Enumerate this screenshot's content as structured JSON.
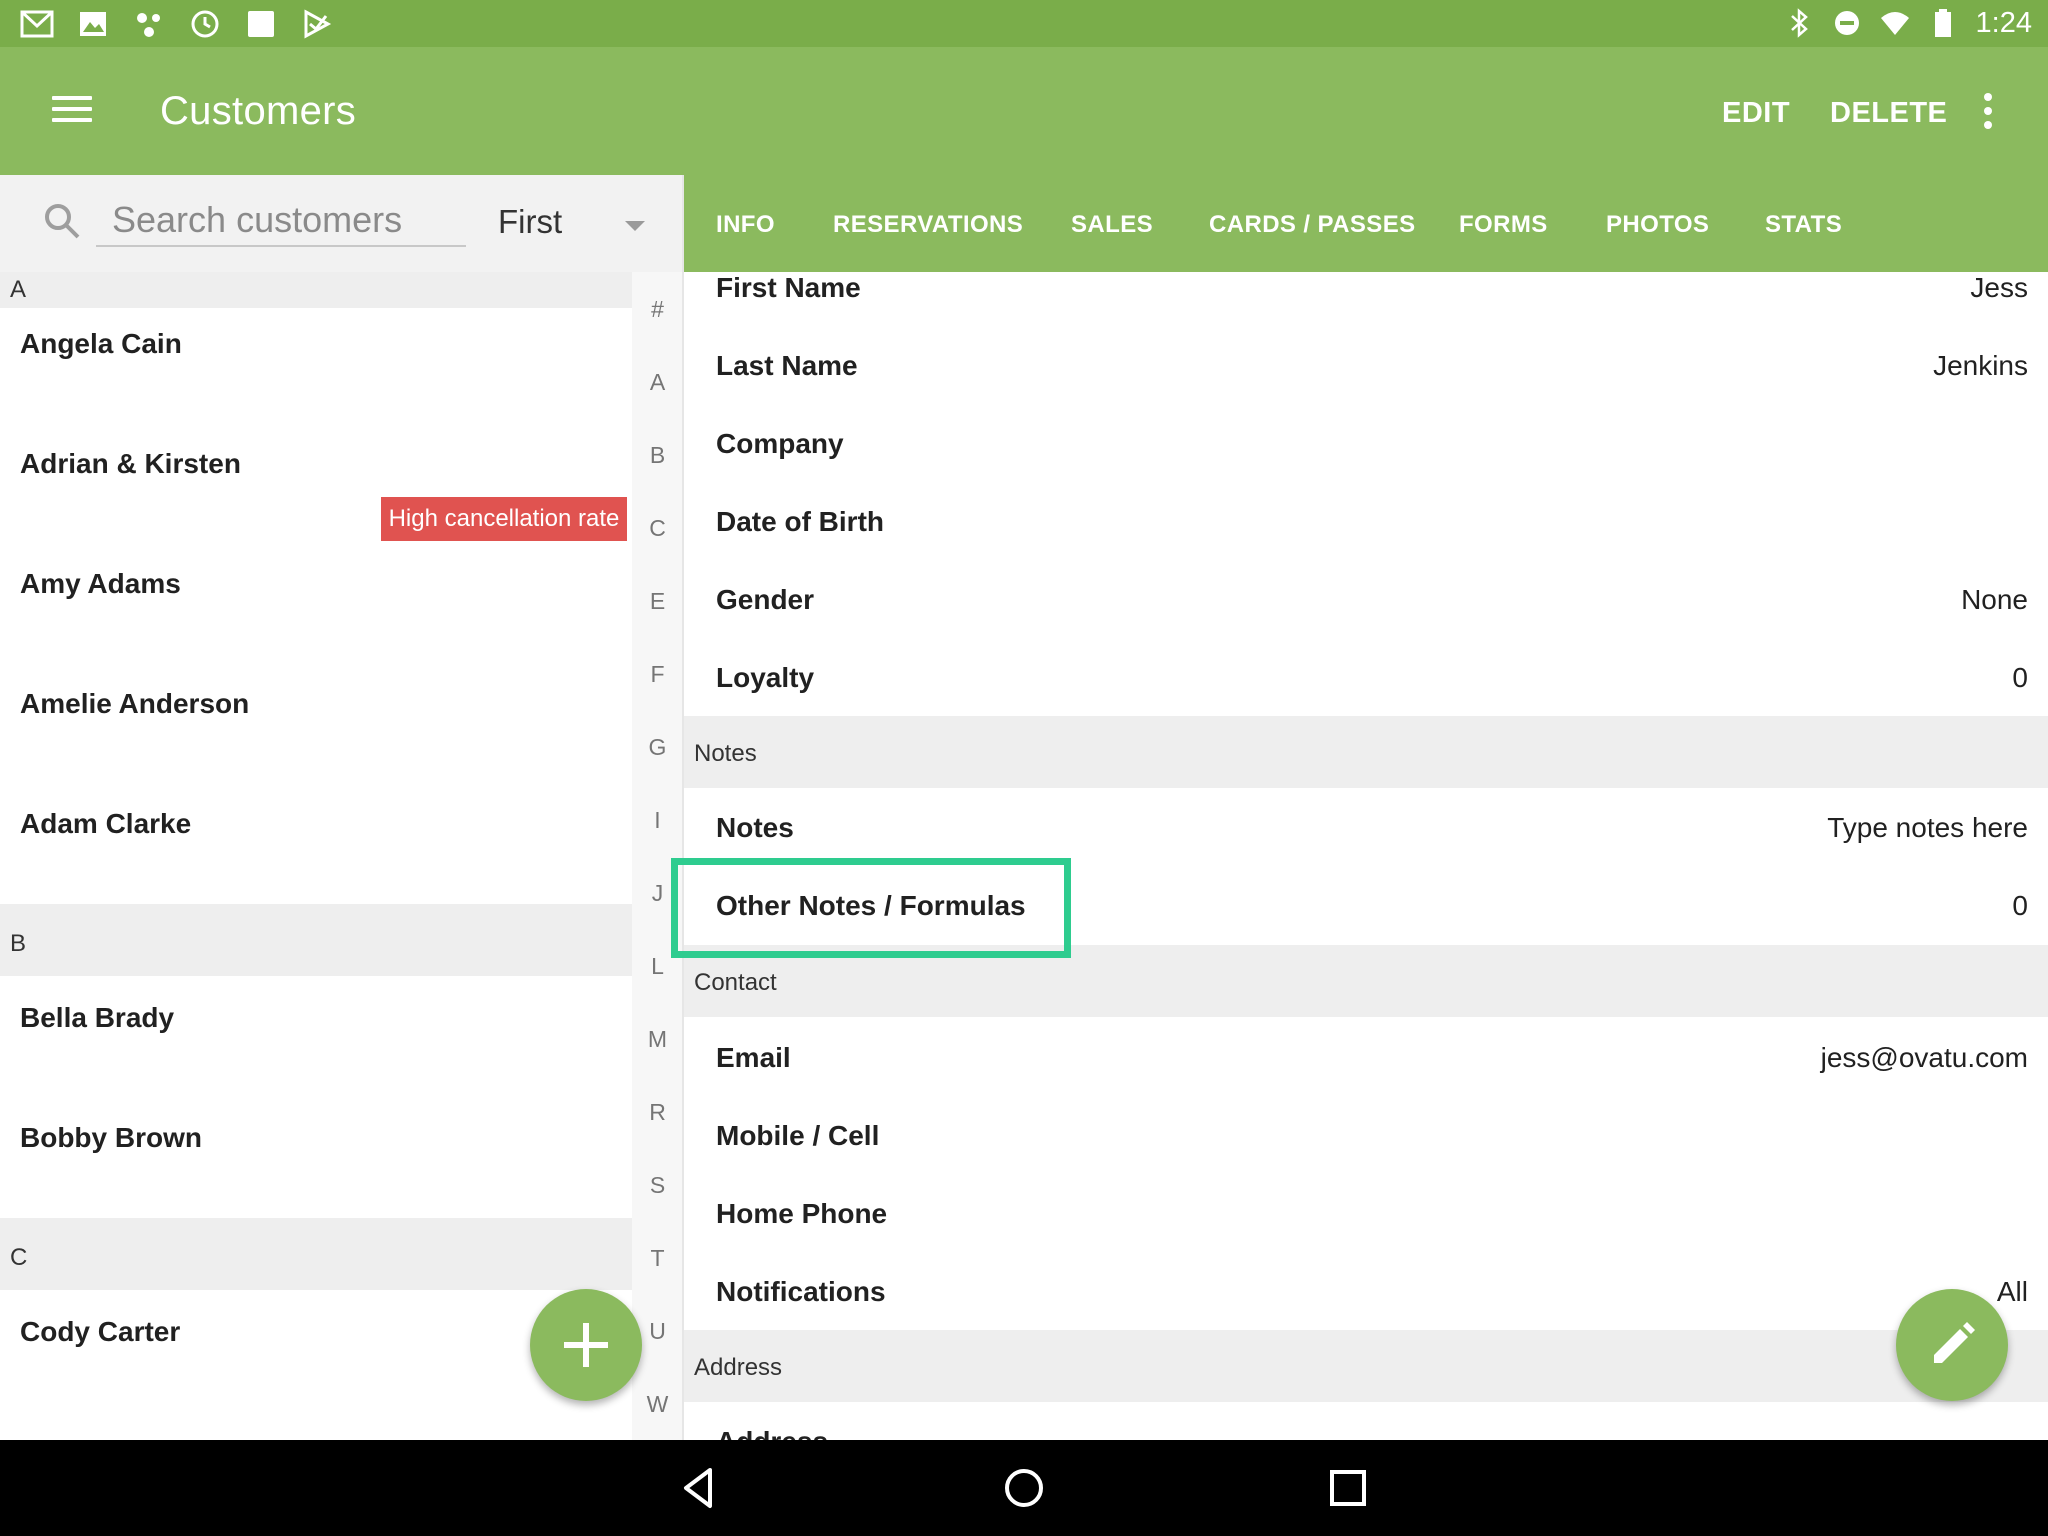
{
  "status_bar": {
    "time": "1:24",
    "left_icons": [
      "gmail-icon",
      "photos-icon",
      "nearby-icon",
      "clock-icon",
      "square-app-icon",
      "play-store-icon"
    ],
    "right_icons": [
      "bluetooth-icon",
      "do-not-disturb-icon",
      "wifi-icon",
      "battery-icon"
    ]
  },
  "app_bar": {
    "title": "Customers",
    "edit_label": "EDIT",
    "delete_label": "DELETE",
    "menu_icon": "hamburger-menu-icon",
    "overflow_icon": "more-vert-icon"
  },
  "search": {
    "placeholder": "Search customers",
    "value": "",
    "sort_value": "First"
  },
  "tabs": [
    {
      "label": "INFO",
      "active": true
    },
    {
      "label": "RESERVATIONS"
    },
    {
      "label": "SALES"
    },
    {
      "label": "CARDS / PASSES"
    },
    {
      "label": "FORMS"
    },
    {
      "label": "PHOTOS"
    },
    {
      "label": "STATS"
    }
  ],
  "customer_list": {
    "sections": [
      {
        "letter": "A",
        "customers": [
          {
            "name": "Angela Cain"
          },
          {
            "name": "Adrian & Kirsten",
            "badge": "High cancellation rate"
          },
          {
            "name": "Amy Adams"
          },
          {
            "name": "Amelie Anderson"
          },
          {
            "name": "Adam Clarke"
          }
        ]
      },
      {
        "letter": "B",
        "customers": [
          {
            "name": "Bella Brady"
          },
          {
            "name": "Bobby Brown"
          }
        ]
      },
      {
        "letter": "C",
        "customers": [
          {
            "name": "Cody Carter"
          }
        ]
      }
    ]
  },
  "alpha_index": [
    "#",
    "A",
    "B",
    "C",
    "E",
    "F",
    "G",
    "I",
    "J",
    "L",
    "M",
    "R",
    "S",
    "T",
    "U",
    "W"
  ],
  "detail": {
    "fields": [
      {
        "label": "First Name",
        "value": "Jess"
      },
      {
        "label": "Last Name",
        "value": "Jenkins"
      },
      {
        "label": "Company",
        "value": ""
      },
      {
        "label": "Date of Birth",
        "value": ""
      },
      {
        "label": "Gender",
        "value": "None"
      },
      {
        "label": "Loyalty",
        "value": "0"
      }
    ],
    "notes_section": "Notes",
    "notes_fields": [
      {
        "label": "Notes",
        "value": "Type notes here"
      },
      {
        "label": "Other Notes / Formulas",
        "value": "0"
      }
    ],
    "contact_section": "Contact",
    "contact_fields": [
      {
        "label": "Email",
        "value": "jess@ovatu.com"
      },
      {
        "label": "Mobile / Cell",
        "value": ""
      },
      {
        "label": "Home Phone",
        "value": ""
      },
      {
        "label": "Notifications",
        "value": "All"
      }
    ],
    "address_section": "Address",
    "address_fields": [
      {
        "label": "Address",
        "value": ""
      }
    ]
  },
  "fabs": {
    "add_icon": "plus-icon",
    "edit_icon": "pencil-icon"
  },
  "colors": {
    "status_bar": "#7aad4a",
    "primary": "#8bba5e",
    "badge": "#e05350",
    "highlight": "#2ecc8f",
    "section_bg": "#eeeeee"
  }
}
